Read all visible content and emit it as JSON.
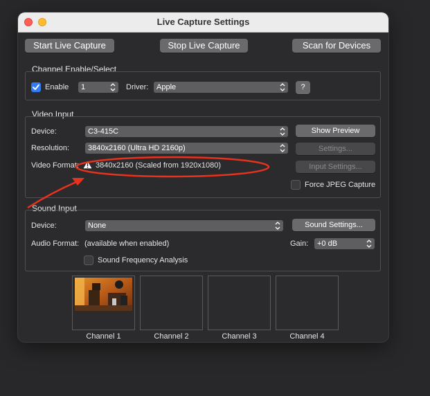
{
  "window": {
    "title": "Live Capture Settings"
  },
  "toolbar": {
    "start_label": "Start Live Capture",
    "stop_label": "Stop Live Capture",
    "scan_label": "Scan for Devices"
  },
  "channel": {
    "group_title": "Channel Enable/Select",
    "enable_label": "Enable",
    "enable_checked": true,
    "channel_value": "1",
    "driver_label": "Driver:",
    "driver_value": "Apple",
    "help_label": "?"
  },
  "video": {
    "group_title": "Video Input",
    "device_label": "Device:",
    "device_value": "C3-415C",
    "resolution_label": "Resolution:",
    "resolution_value": "3840x2160 (Ultra HD 2160p)",
    "format_label": "Video Format:",
    "format_value": "3840x2160 (Scaled from 1920x1080)",
    "show_preview_label": "Show Preview",
    "settings_label": "Settings...",
    "input_settings_label": "Input Settings...",
    "force_jpeg_label": "Force JPEG Capture",
    "force_jpeg_checked": false
  },
  "sound": {
    "group_title": "Sound Input",
    "device_label": "Device:",
    "device_value": "None",
    "sound_settings_label": "Sound Settings...",
    "audio_format_label": "Audio Format:",
    "audio_format_value": "(available when enabled)",
    "gain_label": "Gain:",
    "gain_value": "+0 dB",
    "freq_analysis_label": "Sound Frequency Analysis",
    "freq_analysis_checked": false
  },
  "channels": [
    {
      "label": "Channel 1"
    },
    {
      "label": "Channel 2"
    },
    {
      "label": "Channel 3"
    },
    {
      "label": "Channel 4"
    }
  ],
  "colors": {
    "annotation": "#e8321e",
    "accent": "#2f7cf6",
    "titlebar": "#ececec"
  }
}
